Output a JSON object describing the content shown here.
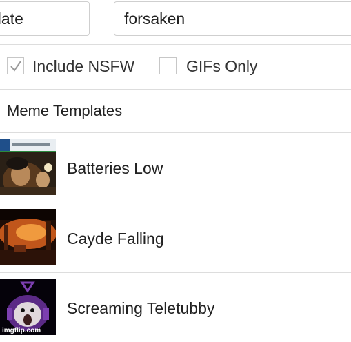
{
  "search": {
    "left_value": "plate",
    "right_value": "forsaken"
  },
  "filters": {
    "nsfw_label": "Include NSFW",
    "nsfw_checked": true,
    "gifs_label": "GIFs Only",
    "gifs_checked": false
  },
  "section": {
    "title": "Meme Templates"
  },
  "templates": [
    {
      "name": "Batteries Low"
    },
    {
      "name": "Cayde Falling"
    },
    {
      "name": "Screaming Teletubby"
    }
  ],
  "watermark": "imgflip.com",
  "colors": {
    "divider": "#dddddd",
    "checkbox_border": "#c7c7c7",
    "check_mark": "#9a9a9a"
  }
}
